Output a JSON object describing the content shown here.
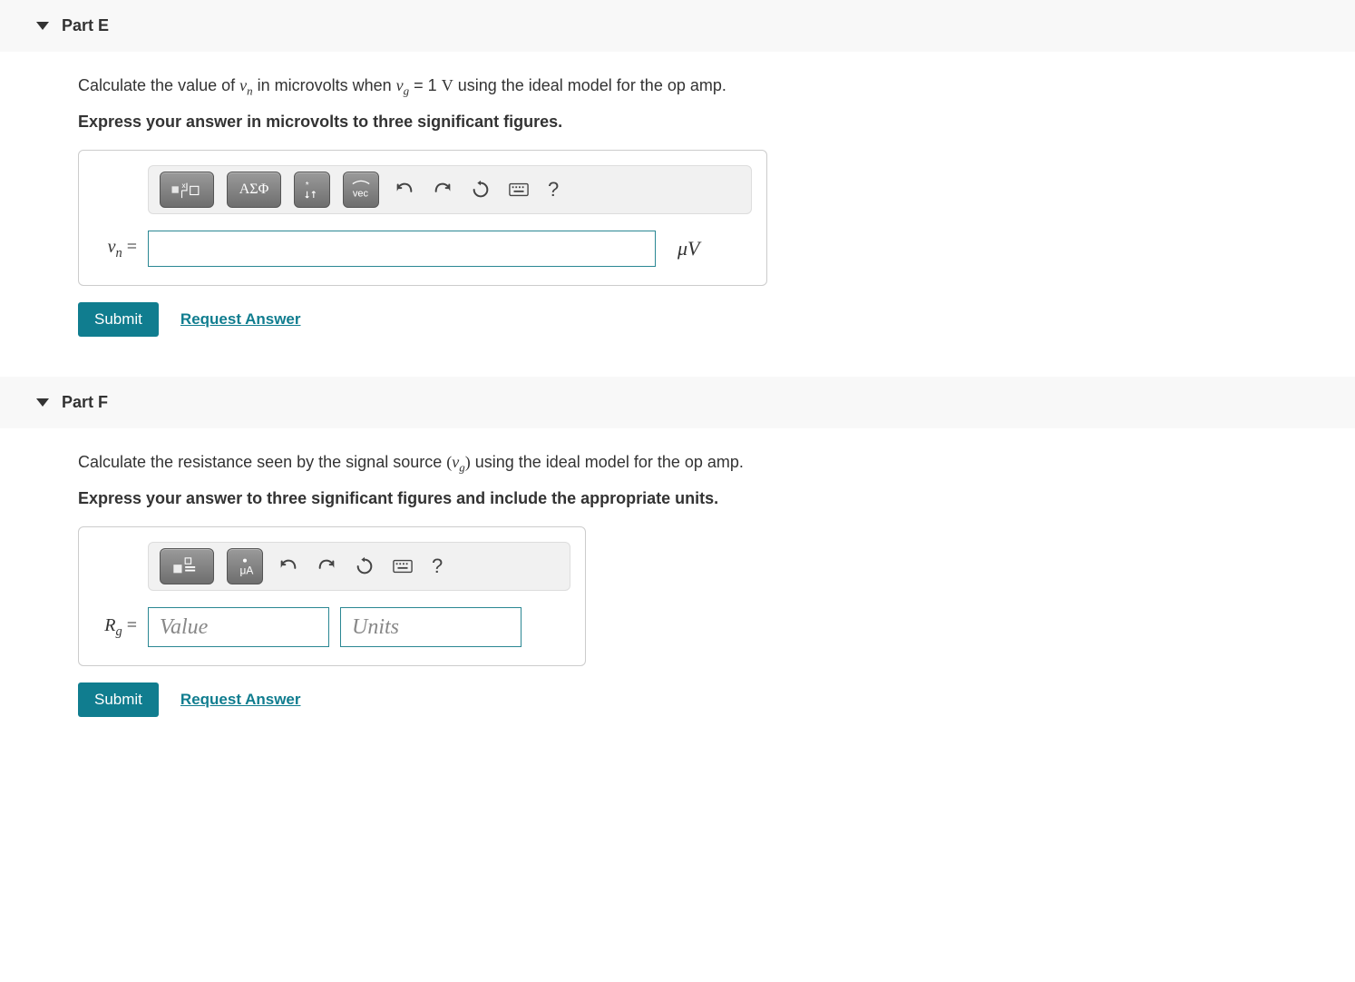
{
  "partE": {
    "title": "Part E",
    "prompt_before_vn": "Calculate the value of ",
    "vn_var": "v",
    "vn_sub": "n",
    "prompt_mid1": " in microvolts when ",
    "vg_var": "v",
    "vg_sub": "g",
    "prompt_mid2": " = 1 ",
    "unitV": "V",
    "prompt_after": " using the ideal model for the op amp.",
    "instruct": "Express your answer in microvolts to three significant figures.",
    "toolbar": {
      "greek_label": "ΑΣΦ",
      "vec_label": "vec",
      "help": "?"
    },
    "var_label_letter": "v",
    "var_label_sub": "n",
    "equals": " = ",
    "unit_display": "μV",
    "submit": "Submit",
    "request": "Request Answer"
  },
  "partF": {
    "title": "Part F",
    "prompt_before": "Calculate the resistance seen by the signal source ",
    "vg_open": "(",
    "vg_var": "v",
    "vg_sub": "g",
    "vg_close": ")",
    "prompt_after": " using the ideal model for the op amp.",
    "instruct": "Express your answer to three significant figures and include the appropriate units.",
    "toolbar": {
      "help": "?"
    },
    "var_label_letter": "R",
    "var_label_sub": "g",
    "equals": " = ",
    "value_placeholder": "Value",
    "units_placeholder": "Units",
    "submit": "Submit",
    "request": "Request Answer"
  }
}
